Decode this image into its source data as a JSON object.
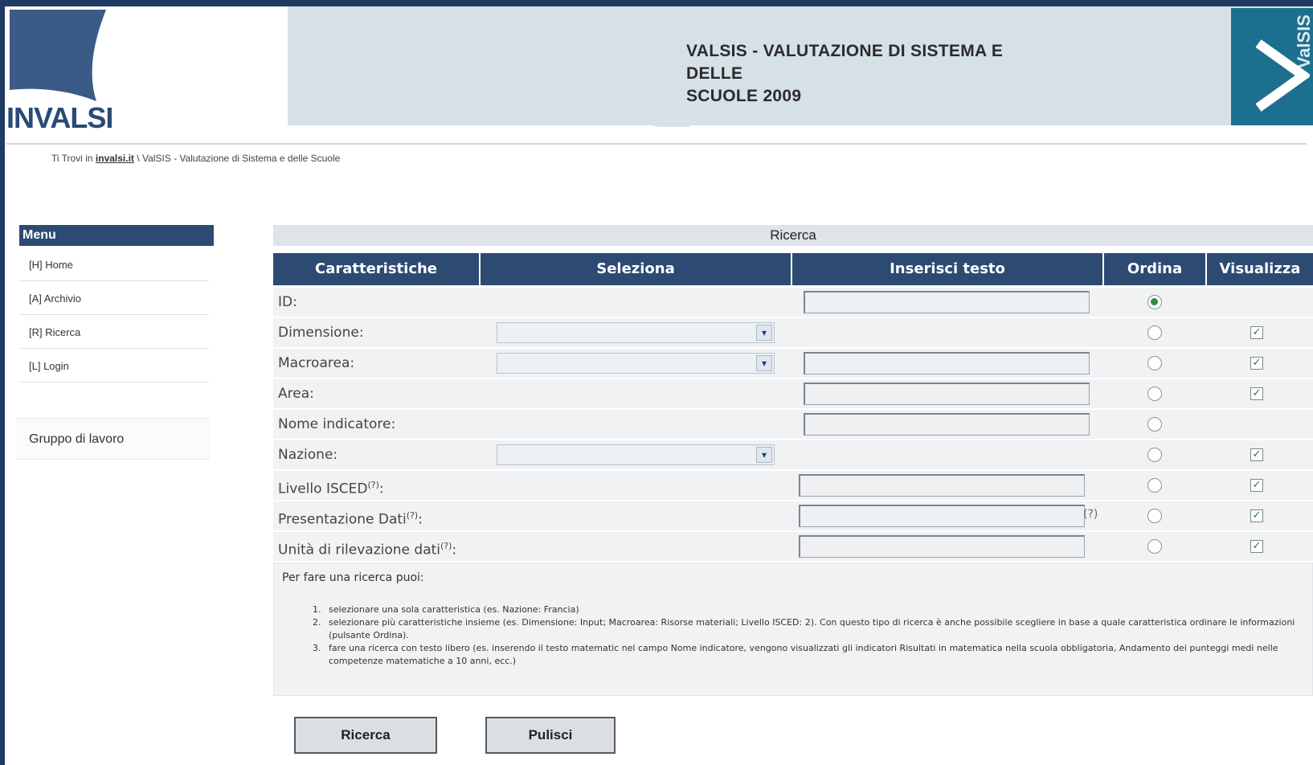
{
  "header": {
    "logo_text": "INVALSI",
    "title_line1": "VALSIS - VALUTAZIONE DI SISTEMA E DELLE",
    "title_line2": "SCUOLE 2009",
    "valsis_logo": "ValSIS"
  },
  "breadcrumb": {
    "prefix": "Ti Trovi in",
    "link": "invalsi.it",
    "rest": "\\ ValSIS - Valutazione di Sistema e delle Scuole"
  },
  "sidebar": {
    "menu_title": "Menu",
    "items": [
      {
        "label": "[H] Home"
      },
      {
        "label": "[A] Archivio"
      },
      {
        "label": "[R] Ricerca"
      },
      {
        "label": "[L] Login"
      }
    ],
    "group_label": "Gruppo di lavoro"
  },
  "search": {
    "title": "Ricerca",
    "columns": [
      "Caratteristiche",
      "Seleziona",
      "Inserisci testo",
      "Ordina",
      "Visualizza"
    ],
    "rows": [
      {
        "label": "ID:",
        "select": false,
        "text": true,
        "order_selected": true,
        "show": false
      },
      {
        "label": "Dimensione:",
        "select": true,
        "text": false,
        "order_selected": false,
        "show": true
      },
      {
        "label": "Macroarea:",
        "select": true,
        "text": true,
        "order_selected": false,
        "show": true
      },
      {
        "label": "Area:",
        "select": false,
        "text": true,
        "order_selected": false,
        "show": true
      },
      {
        "label": "Nome indicatore:",
        "select": false,
        "text": true,
        "order_selected": false,
        "show": false
      },
      {
        "label": "Nazione:",
        "select": true,
        "text": false,
        "order_selected": false,
        "show": true
      },
      {
        "label": "Livello ISCED",
        "sup": "(?)",
        "suffix": ":",
        "select": false,
        "text": true,
        "order_selected": false,
        "show": true
      },
      {
        "label": "Presentazione Dati",
        "sup": "(?)",
        "suffix": ":",
        "select": false,
        "text": true,
        "order_selected": false,
        "show": true
      },
      {
        "label": "Unità di rilevazione dati",
        "sup": "(?)",
        "suffix": ":",
        "select": false,
        "text": true,
        "order_selected": false,
        "show": true
      }
    ],
    "hint": "(?)",
    "info_intro": "Per fare una ricerca puoi:",
    "info_items": [
      "selezionare una sola caratteristica (es. Nazione: Francia)",
      "selezionare più caratteristiche insieme (es. Dimensione: Input; Macroarea: Risorse materiali; Livello ISCED: 2). Con questo tipo di ricerca è anche possibile scegliere in base a quale caratteristica ordinare le informazioni (pulsante Ordina).",
      "fare una ricerca con testo libero (es. inserendo il testo matematic nel campo Nome indicatore, vengono visualizzati gli indicatori Risultati in matematica nella scuola obbligatoria, Andamento dei punteggi medi nelle competenze matematiche a 10 anni, ecc.)"
    ],
    "buttons": {
      "search": "Ricerca",
      "clear": "Pulisci"
    }
  }
}
